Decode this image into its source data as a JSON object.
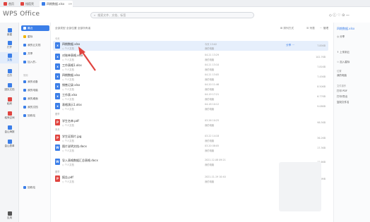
{
  "tabs": [
    {
      "label": "首页",
      "color": "#e0443f"
    },
    {
      "label": "找稻壳",
      "color": "#e0443f"
    },
    {
      "label": "四期数据.xlsx",
      "color": "#3b7ee8"
    }
  ],
  "app": {
    "logo": "WPS Office",
    "search_placeholder": "搜索文件、文档、标签",
    "window_controls": "◇ ⓘ ♡ ⊙ —"
  },
  "rail": [
    {
      "label": "新建",
      "active": false,
      "color": "#3b7ee8"
    },
    {
      "label": "打开",
      "active": false,
      "color": "#3b7ee8"
    },
    {
      "label": "文档",
      "active": true,
      "color": "#3b7ee8"
    },
    {
      "label": "日历",
      "active": false,
      "color": "#3b7ee8"
    },
    {
      "label": "团队文档",
      "active": false,
      "color": "#3b7ee8"
    },
    {
      "label": "稻壳",
      "active": false,
      "color": "#e0443f"
    },
    {
      "label": "稻壳空间",
      "active": false,
      "color": "#e0443f"
    },
    {
      "label": "金山海报",
      "active": false,
      "color": "#3b7ee8"
    },
    {
      "label": "金山表单",
      "active": false,
      "color": "#3b7ee8"
    },
    {
      "label": "应用",
      "active": false,
      "color": "#555555"
    }
  ],
  "sidebar": {
    "items": [
      {
        "label": "最近",
        "active": true
      },
      {
        "label": "星标",
        "active": false
      },
      {
        "label": "我的云文档",
        "active": false
      },
      {
        "label": "共享",
        "active": false
      },
      {
        "label": "加入的..",
        "active": false
      }
    ],
    "section": "常用",
    "items2": [
      {
        "label": "我的设备"
      },
      {
        "label": "我的电脑"
      },
      {
        "label": "我的桌面"
      },
      {
        "label": "我的文档"
      },
      {
        "label": "回收站"
      }
    ],
    "bottom": "回收站"
  },
  "main": {
    "breadcrumb": "全部类型  全部位置  全部所有者",
    "tools": [
      "⊞ 排列方式",
      "☰ 列表",
      "⋯ 管理"
    ],
    "groups": {
      "today": "今天",
      "earlier": "更早",
      "month": "本月",
      "older": "更早"
    },
    "files": [
      {
        "name": "四期数据.xlsx",
        "sub": "◇ 个人文档",
        "date": "今天 13:02",
        "sub2": "我的电脑",
        "size": "7.85KB",
        "type": "x",
        "color": "#3b7ee8",
        "selected": true,
        "act": "分享  ···"
      },
      {
        "name": "对账单表格.xlsx",
        "sub": "◇ 个人文档",
        "date": "04-21 13:29",
        "sub2": "我的电脑",
        "size": "102.7KB",
        "type": "x",
        "color": "#3b7ee8",
        "selected": false,
        "act": ""
      },
      {
        "name": "工作表格1.xlsx",
        "sub": "◇ 个人文档",
        "date": "04-21 13:10",
        "sub2": "我的电脑",
        "size": "7.81KB",
        "type": "x",
        "color": "#3b7ee8",
        "selected": false,
        "act": ""
      },
      {
        "name": "四期数据.xlsx",
        "sub": "◇ 个人文档",
        "date": "04-21 13:05",
        "sub2": "我的电脑",
        "size": "7.45KB",
        "type": "x",
        "color": "#3b7ee8",
        "selected": false,
        "act": ""
      },
      {
        "name": "销售记录.xlsx",
        "sub": "◇ 个人文档",
        "date": "04-20 11:46",
        "sub2": "我的电脑",
        "size": "8.50KB",
        "type": "x",
        "color": "#3b7ee8",
        "selected": false,
        "act": ""
      },
      {
        "name": "工作表.xlsx",
        "sub": "◇ 个人文档",
        "date": "04-19 17:21",
        "sub2": "我的电脑",
        "size": "6.77KB",
        "type": "x",
        "color": "#3b7ee8",
        "selected": false,
        "act": ""
      },
      {
        "name": "表格演示1.xlsx",
        "sub": "◇ 个人文档",
        "date": "04-18 10:12",
        "sub2": "我的电脑",
        "size": "9.08KB",
        "type": "x",
        "color": "#3b7ee8",
        "selected": false,
        "act": ""
      },
      {
        "name": "学生名单.pdf",
        "sub": "◇ 个人文档",
        "date": "03-26 10:25",
        "sub2": "我的电脑",
        "size": "98.5KB",
        "type": "P",
        "color": "#e0443f",
        "selected": false,
        "act": ""
      },
      {
        "name": "学生证照片.jpg",
        "sub": "◇ 个人文档",
        "date": "03-22 14:18",
        "sub2": "我的电脑",
        "size": "36.2KB",
        "type": "P",
        "color": "#e0443f",
        "selected": false,
        "act": ""
      },
      {
        "name": "图片说明文档.docx",
        "sub": "◇ 个人文档",
        "date": "03-20 08:05",
        "sub2": "我的电脑",
        "size": "17.3KB",
        "type": "W",
        "color": "#3b7ee8",
        "selected": false,
        "act": ""
      },
      {
        "name": "导入表格数据汇总表格.docx",
        "sub": "◇ 个人文档",
        "date": "2021-12-08 09:21",
        "sub2": "我的电脑",
        "size": "12.6KB",
        "type": "W",
        "color": "#3b7ee8",
        "selected": false,
        "act": ""
      },
      {
        "name": "报告.pdf",
        "sub": "◇ 个人文档",
        "date": "2021-11-19 10:40",
        "sub2": "我的电脑",
        "size": "1.48MB",
        "type": "P",
        "color": "#e0443f",
        "selected": false,
        "act": ""
      }
    ]
  },
  "rightpanel": {
    "title": "四期数据.xlsx",
    "actions": [
      "◎ 分享",
      "⇪ 上传到云",
      "☆ 加入星标"
    ],
    "section1": "位置",
    "loc": "我的电脑",
    "section2": "文件操作",
    "ops": [
      "打印 PDF",
      "打印/导出",
      "复制文件名"
    ]
  }
}
